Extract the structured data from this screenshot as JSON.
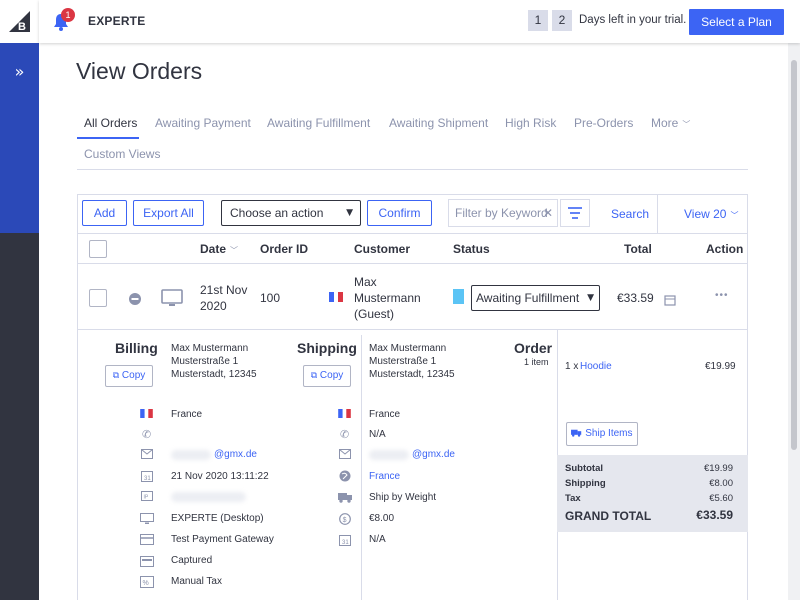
{
  "topbar": {
    "store_name": "EXPERTE",
    "notification_count": "1",
    "trial_days": [
      "1",
      "2"
    ],
    "trial_text": "Days left in your trial.",
    "select_plan": "Select a Plan"
  },
  "page": {
    "title": "View Orders",
    "tabs": [
      "All Orders",
      "Awaiting Payment",
      "Awaiting Fulfillment",
      "Awaiting Shipment",
      "High Risk",
      "Pre-Orders",
      "More"
    ],
    "custom_views": "Custom Views"
  },
  "toolbar": {
    "add": "Add",
    "export_all": "Export All",
    "action_select": "Choose an action",
    "confirm": "Confirm",
    "filter_placeholder": "Filter by Keyword",
    "search": "Search",
    "view": "View 20"
  },
  "table": {
    "headers": {
      "date": "Date",
      "order_id": "Order ID",
      "customer": "Customer",
      "status": "Status",
      "total": "Total",
      "action": "Action"
    },
    "row": {
      "date_line1": "21st Nov",
      "date_line2": "2020",
      "order_id": "100",
      "customer_line1": "Max",
      "customer_line2": "Mustermann",
      "customer_line3": "(Guest)",
      "status": "Awaiting Fulfillment",
      "total": "€33.59",
      "more": "•••"
    }
  },
  "billing": {
    "title": "Billing",
    "copy": "Copy",
    "name": "Max Mustermann",
    "street": "Musterstraße 1",
    "city": "Musterstadt, 12345",
    "country": "France",
    "email": "@gmx.de",
    "date": "21 Nov 2020 13:11:22",
    "device": "EXPERTE (Desktop)",
    "gateway": "Test Payment Gateway",
    "payment_status": "Captured",
    "tax": "Manual Tax"
  },
  "shipping": {
    "title": "Shipping",
    "copy": "Copy",
    "name": "Max Mustermann",
    "street": "Musterstraße 1",
    "city": "Musterstadt, 12345",
    "country": "France",
    "phone": "N/A",
    "email": "@gmx.de",
    "country_link": "France",
    "method": "Ship by Weight",
    "cost": "€8.00",
    "date": "N/A"
  },
  "order": {
    "title": "Order",
    "items_count": "1 item",
    "qty": "1 x",
    "item_name": "Hoodie",
    "item_price": "€19.99",
    "ship_items": "Ship Items",
    "subtotal_label": "Subtotal",
    "subtotal": "€19.99",
    "shipping_label": "Shipping",
    "shipping": "€8.00",
    "tax_label": "Tax",
    "tax": "€5.60",
    "grand_total_label": "GRAND TOTAL",
    "grand_total": "€33.59"
  },
  "colors": {
    "accent": "#3c64f4",
    "sidebar": "#313440",
    "sidebar_active": "#2b49b8",
    "status": "#5bc4f5",
    "badge": "#db3643"
  }
}
